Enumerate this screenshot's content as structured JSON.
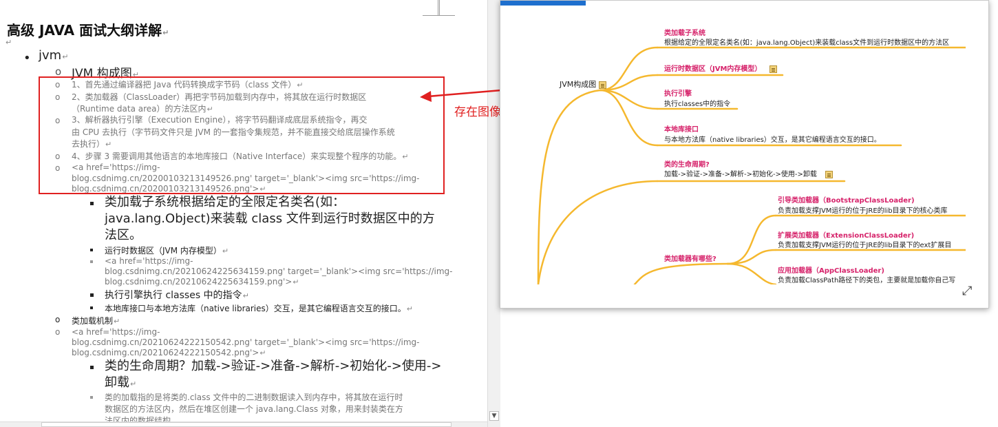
{
  "document": {
    "heading": "高级 JAVA 面试大纲详解",
    "para_mark": "↵",
    "items": {
      "jvm": "jvm",
      "jvm_structure": "JVM 构成图",
      "step1": "1、首先通过编译器把 Java 代码转换成字节码（class 文件）",
      "step2_a": "2、类加载器（ClassLoader）再把字节码加载到内存中，将其放在运行时数据区",
      "step2_b": "（Runtime data area）的方法区内",
      "step3_a": "3、解析器执行引擎（Execution Engine），将字节码翻译成底层系统指令，再交",
      "step3_b": "由 CPU 去执行（字节码文件只是 JVM 的一套指令集规范，并不能直接交给底层操作系统",
      "step3_c": "去执行）",
      "step4": "4、步骤 3 需要调用其他语言的本地库接口（Native Interface）来实现整个程序的功能。",
      "img1_a": "<a href='https://img-",
      "img1_b": "blog.csdnimg.cn/20200103213149526.png' target='_blank'><img src='https://img-",
      "img1_c": "blog.csdnimg.cn/20200103213149526.png'>",
      "cls_loader_a": "类加载子系统根据给定的全限定名类名(如：",
      "cls_loader_b": "java.lang.Object)来装载 class 文件到运行时数据区中的方",
      "cls_loader_c": "法区。",
      "runtime_area": "运行时数据区（JVM 内存模型）",
      "img2_a": "<a href='https://img-",
      "img2_b": "blog.csdnimg.cn/20210624225634159.png' target='_blank'><img src='https://img-",
      "img2_c": "blog.csdnimg.cn/20210624225634159.png'>",
      "exec_engine": "执行引擎执行 classes 中的指令",
      "native_lib": "本地库接口与本地方法库（native libraries）交互，是其它编程语言交互的接口。",
      "class_loading": "类加载机制",
      "img3_a": "<a href='https://img-",
      "img3_b": "blog.csdnimg.cn/20210624222150542.png' target='_blank'><img src='https://img-",
      "img3_c": "blog.csdnimg.cn/20210624222150542.png'>",
      "lifecycle_a": "类的生命周期？加载->验证->准备->解析->初始化->使用->",
      "lifecycle_b": "卸载",
      "loading_a": "类的加载指的是将类的.class 文件中的二进制数据读入到内存中，将其放在运行时",
      "loading_b": "数据区的方法区内，然后在堆区创建一个 java.lang.Class 对象，用来封装类在方",
      "loading_c": "法区内的数据结构。"
    }
  },
  "annotation": {
    "text": "存在图像中未显示的内容",
    "color": "#e02020"
  },
  "mindmap": {
    "root": "JVM构成图",
    "nodes": {
      "n1_title": "类加载子系统",
      "n1_text": "根据给定的全限定名类名(如：java.lang.Object)来装载class文件到运行时数据区中的方法区",
      "n2_title": "运行时数据区（JVM内存模型）",
      "n3_title": "执行引擎",
      "n3_text": "执行classes中的指令",
      "n4_title": "本地库接口",
      "n4_text": "与本地方法库（native libraries）交互，是其它编程语言交互的接口。",
      "n5_title": "类的生命周期?",
      "n5_text": "加载->验证->准备->解析->初始化->使用->卸载",
      "n6_title": "类加载器有哪些?",
      "c1_title": "引导类加载器（BootstrapClassLoader)",
      "c1_text": "负责加载支撑JVM运行的位于JRE的lib目录下的核心类库",
      "c2_title": "扩展类加载器（ExtensionClassLoader)",
      "c2_text": "负责加载支撑JVM运行的位于JRE的lib目录下的ext扩展目",
      "c3_title": "应用加载器（AppClassLoader)",
      "c3_text": "负责加载ClassPath路径下的类包，主要就是加载你自己写"
    },
    "branch_color": "#f5b82e",
    "title_color": "#d6226a"
  }
}
